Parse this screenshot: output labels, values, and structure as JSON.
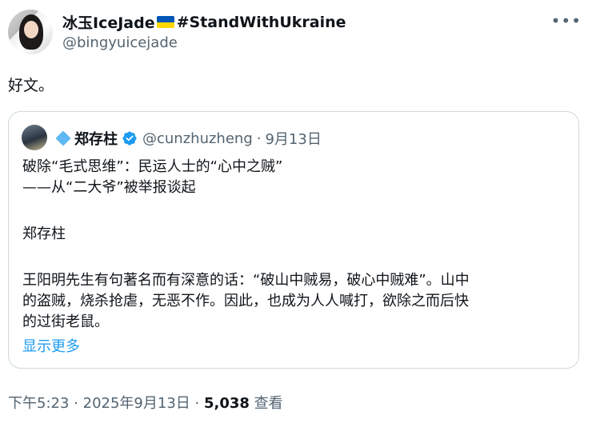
{
  "author": {
    "name": "冰玉IceJade",
    "hashtag": "#StandWithUkraine",
    "handle": "@bingyuicejade"
  },
  "more_icon": "more-horizontal-icon",
  "tweet_text": "好文。",
  "quote": {
    "name": "郑存柱",
    "handle": "@cunzhuzheng",
    "separator": "·",
    "date": "9月13日",
    "lines": [
      "破除“毛式思维”：民运人士的“心中之贼”",
      "——从“二大爷”被举报谈起",
      "",
      "郑存柱",
      "",
      "王阳明先生有句著名而有深意的话：“破山中贼易，破心中贼难”。山中",
      "的盗贼，烧杀抢虐，无恶不作。因此，也成为人人喊打，欲除之而后快",
      "的过街老鼠。"
    ],
    "show_more": "显示更多"
  },
  "footer": {
    "time": "下午5:23",
    "separator": "·",
    "date": "2025年9月13日",
    "views_count": "5,038",
    "views_label": "查看"
  },
  "colors": {
    "text": "#0f1419",
    "secondary": "#536471",
    "link": "#1d9bf0",
    "border": "#cfd9de",
    "flag_blue": "#0057b7",
    "flag_yellow": "#ffd700"
  }
}
